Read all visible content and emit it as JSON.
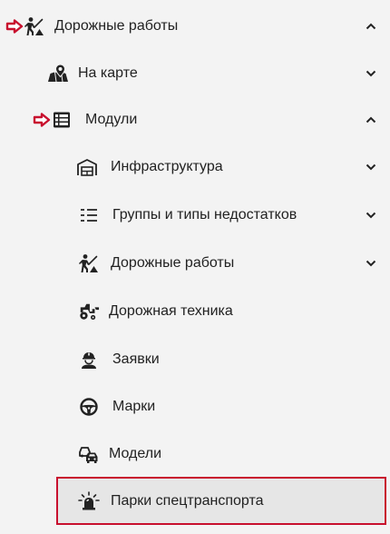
{
  "menu": {
    "road_works": {
      "label": "Дорожные работы",
      "icon": "road-worker-icon",
      "state": "expanded"
    },
    "on_map": {
      "label": "На карте",
      "icon": "map-pin-icon",
      "state": "collapsed"
    },
    "modules": {
      "label": "Модули",
      "icon": "table-icon",
      "state": "expanded"
    },
    "infrastructure": {
      "label": "Инфраструктура",
      "icon": "warehouse-icon",
      "state": "collapsed"
    },
    "defect_groups": {
      "label": "Группы и типы недостатков",
      "icon": "list-icon",
      "state": "collapsed"
    },
    "road_works_sub": {
      "label": "Дорожные работы",
      "icon": "road-worker-icon",
      "state": "collapsed"
    },
    "road_machinery": {
      "label": "Дорожная техника",
      "icon": "tractor-icon"
    },
    "requests": {
      "label": "Заявки",
      "icon": "worker-helmet-icon"
    },
    "brands": {
      "label": "Марки",
      "icon": "steering-wheel-icon"
    },
    "models": {
      "label": "Модели",
      "icon": "cars-icon"
    },
    "special_fleets": {
      "label": "Парки спецтранспорта",
      "icon": "siren-icon",
      "state": "selected"
    }
  },
  "colors": {
    "background": "#f3f3f3",
    "text": "#222222",
    "pointer_arrow": "#c8102e",
    "selected_border": "#c8102e",
    "selected_background": "#e6e6e6"
  }
}
